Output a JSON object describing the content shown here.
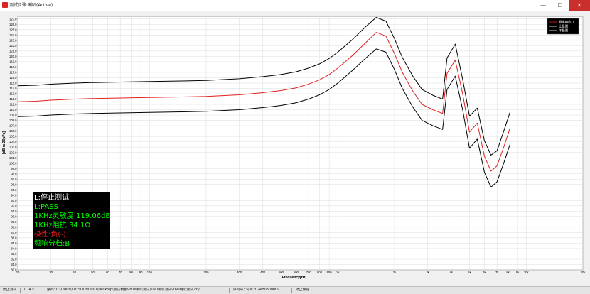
{
  "window": {
    "title": "测试步骤:喇叭(Active)",
    "icon": "app-icon",
    "controls": {
      "minimize": "—",
      "maximize": "☐",
      "close": "✕"
    }
  },
  "status_bar": {
    "state": "停止测试",
    "elapsed": "1.74 s",
    "file_label": "序列：",
    "file_path": "C:\\Users\\CRYSOUND001\\Desktop\\测试模板V8.0\\喇叭测试\\16Ω喇叭测试\\16Ω喇叭测试.cry",
    "serial_label": "序列号：",
    "serial": "S/N:2024H0800009",
    "save_state": "停止保存"
  },
  "overlay": {
    "lines": [
      {
        "text": "L:停止测试",
        "color": "#ffffff"
      },
      {
        "text": "L:PASS",
        "color": "#00ff00"
      },
      {
        "text": "1KHz灵敏度:119.06dB",
        "color": "#00ff00"
      },
      {
        "text": "1KHz阻抗:34.1Ω",
        "color": "#00ff00"
      },
      {
        "text": "极性:负(-)",
        "color": "#ff2020"
      },
      {
        "text": "频响分档:B",
        "color": "#00ff00"
      }
    ]
  },
  "chart_data": {
    "type": "line",
    "title": "",
    "xlabel": "Frequency[Hz]",
    "ylabel": "[dB re 20µPa]",
    "x_scale": "log",
    "xlim": [
      20,
      20000
    ],
    "ylim": [
      80,
      127.5
    ],
    "grid": true,
    "legend_position": "top-right",
    "x_ticks": [
      20,
      30,
      40,
      50,
      60,
      70,
      80,
      90,
      100,
      200,
      300,
      400,
      500,
      600,
      700,
      800,
      900,
      1000,
      2000,
      3000,
      4000,
      5000,
      6000,
      7000,
      8000,
      9000,
      10000,
      20000
    ],
    "x_tick_labels": [
      "20",
      "30",
      "40",
      "50",
      "60",
      "70",
      "80",
      "90",
      "100",
      "200",
      "300",
      "400",
      "500",
      "600",
      "700",
      "800",
      "900",
      "1k",
      "2k",
      "3k",
      "4k",
      "5k",
      "6k",
      "7k",
      "8k",
      "9k",
      "10k",
      "20k"
    ],
    "y_tick_start": 80.0,
    "y_tick_end": 127.0,
    "y_tick_step": 1.0,
    "x": [
      20,
      25,
      30,
      40,
      50,
      70,
      100,
      150,
      200,
      300,
      400,
      500,
      600,
      700,
      800,
      900,
      1000,
      1200,
      1400,
      1600,
      1800,
      2000,
      2200,
      2500,
      2800,
      3200,
      3600,
      3800,
      4200,
      4600,
      5000,
      5500,
      6000,
      6500,
      7000,
      7600,
      8200
    ],
    "series": [
      {
        "name": "频率响应-1",
        "color": "#e02020",
        "values": [
          111.5,
          111.6,
          111.8,
          112.0,
          112.1,
          112.2,
          112.3,
          112.4,
          112.5,
          112.8,
          113.2,
          113.6,
          114.1,
          114.8,
          115.6,
          116.6,
          117.8,
          120.2,
          122.5,
          124.5,
          123.8,
          120.5,
          117.0,
          113.5,
          111.0,
          110.0,
          109.3,
          116.8,
          119.3,
          113.0,
          105.8,
          107.5,
          101.3,
          98.5,
          99.5,
          103.0,
          106.5
        ]
      },
      {
        "name": "上极限",
        "color": "#000000",
        "values": [
          114.5,
          114.6,
          114.8,
          115.0,
          115.1,
          115.2,
          115.3,
          115.4,
          115.5,
          115.8,
          116.2,
          116.6,
          117.1,
          117.8,
          118.6,
          119.6,
          120.8,
          123.2,
          125.5,
          127.3,
          126.6,
          123.3,
          119.8,
          116.3,
          113.8,
          112.7,
          112.0,
          119.7,
          122.3,
          115.7,
          108.8,
          110.3,
          104.2,
          101.5,
          102.3,
          106.0,
          109.5
        ]
      },
      {
        "name": "下极限",
        "color": "#000000",
        "values": [
          108.7,
          108.8,
          109.0,
          109.2,
          109.3,
          109.4,
          109.5,
          109.6,
          109.7,
          110.0,
          110.4,
          110.8,
          111.3,
          112.0,
          112.8,
          113.8,
          115.0,
          117.4,
          119.6,
          121.4,
          120.8,
          117.5,
          114.0,
          110.5,
          108.0,
          107.0,
          106.3,
          113.8,
          116.3,
          110.0,
          102.8,
          104.5,
          98.3,
          95.5,
          96.5,
          100.0,
          103.5
        ]
      }
    ]
  }
}
